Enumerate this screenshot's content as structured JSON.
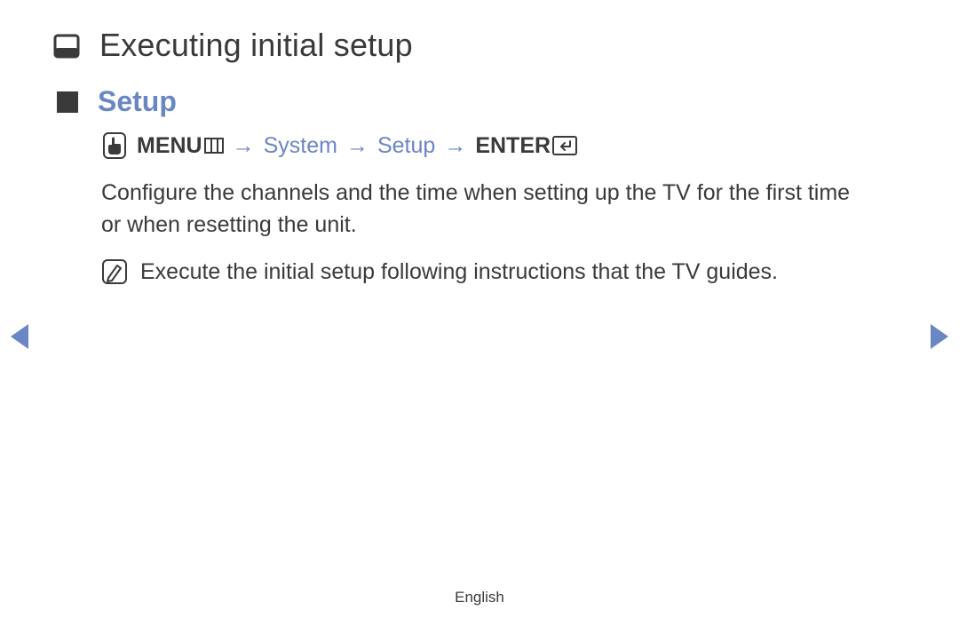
{
  "header": {
    "title": "Executing initial setup"
  },
  "section": {
    "title": "Setup"
  },
  "path": {
    "menu_label": "MENU",
    "arrow1": "→",
    "step1": "System",
    "arrow2": "→",
    "step2": "Setup",
    "arrow3": "→",
    "enter_label": "ENTER"
  },
  "body": {
    "p1": "Configure the channels and the time when setting up the TV for the first time or when resetting the unit.",
    "note": "Execute the initial setup following instructions that the TV guides."
  },
  "footer": {
    "language": "English"
  }
}
